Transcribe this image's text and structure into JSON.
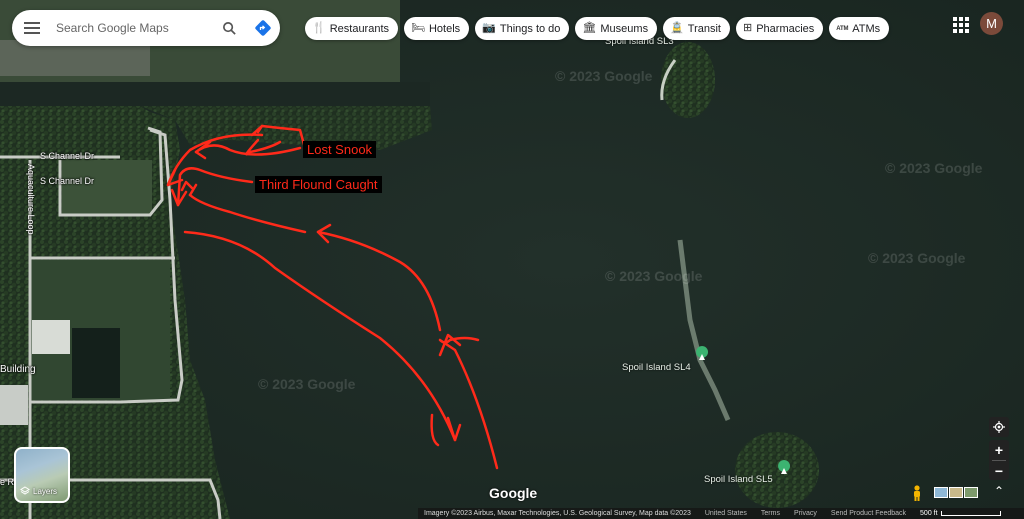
{
  "search": {
    "placeholder": "Search Google Maps"
  },
  "chips": [
    {
      "label": "Restaurants",
      "icon": "utensils-icon",
      "glyph": "🍴"
    },
    {
      "label": "Hotels",
      "icon": "bed-icon",
      "glyph": "🛏"
    },
    {
      "label": "Things to do",
      "icon": "camera-icon",
      "glyph": "📷"
    },
    {
      "label": "Museums",
      "icon": "museum-icon",
      "glyph": "🏛"
    },
    {
      "label": "Transit",
      "icon": "train-icon",
      "glyph": "🚊"
    },
    {
      "label": "Pharmacies",
      "icon": "pharmacy-icon",
      "glyph": "⊞"
    },
    {
      "label": "ATMs",
      "icon": "atm-icon",
      "glyph": "ATM"
    }
  ],
  "account": {
    "initial": "M",
    "color": "#7b4a3a"
  },
  "map_labels": {
    "s_channel_dr_1": "S Channel Dr",
    "s_channel_dr_2": "S Channel Dr",
    "aquaculture_loop": "Aquaculture Loop",
    "building": "Building",
    "road_fragment": "e Rd"
  },
  "islands": {
    "sl3": "Spoil Island SL3",
    "sl4": "Spoil Island SL4",
    "sl5": "Spoil Island SL5"
  },
  "watermarks": [
    "© 2023 Google",
    "© 2023 Google",
    "© 2023 Google",
    "© 2023 Google",
    "© 2023 Google"
  ],
  "annotations": {
    "lost_snook": "Lost Snook",
    "third_flounder": "Third Flound Caught",
    "color": "#ff2a1a"
  },
  "layers": {
    "label": "Layers"
  },
  "brand": {
    "logo": "Google"
  },
  "footer": {
    "attribution": "Imagery ©2023 Airbus, Maxar Technologies, U.S. Geological Survey, Map data ©2023",
    "country": "United States",
    "terms": "Terms",
    "privacy": "Privacy",
    "feedback": "Send Product Feedback",
    "scale": "500 ft"
  },
  "colors": {
    "water": "#1e2c25",
    "land": "#2b3a2a",
    "road": "#c9ccc6",
    "accent_blue": "#1a73e8"
  }
}
